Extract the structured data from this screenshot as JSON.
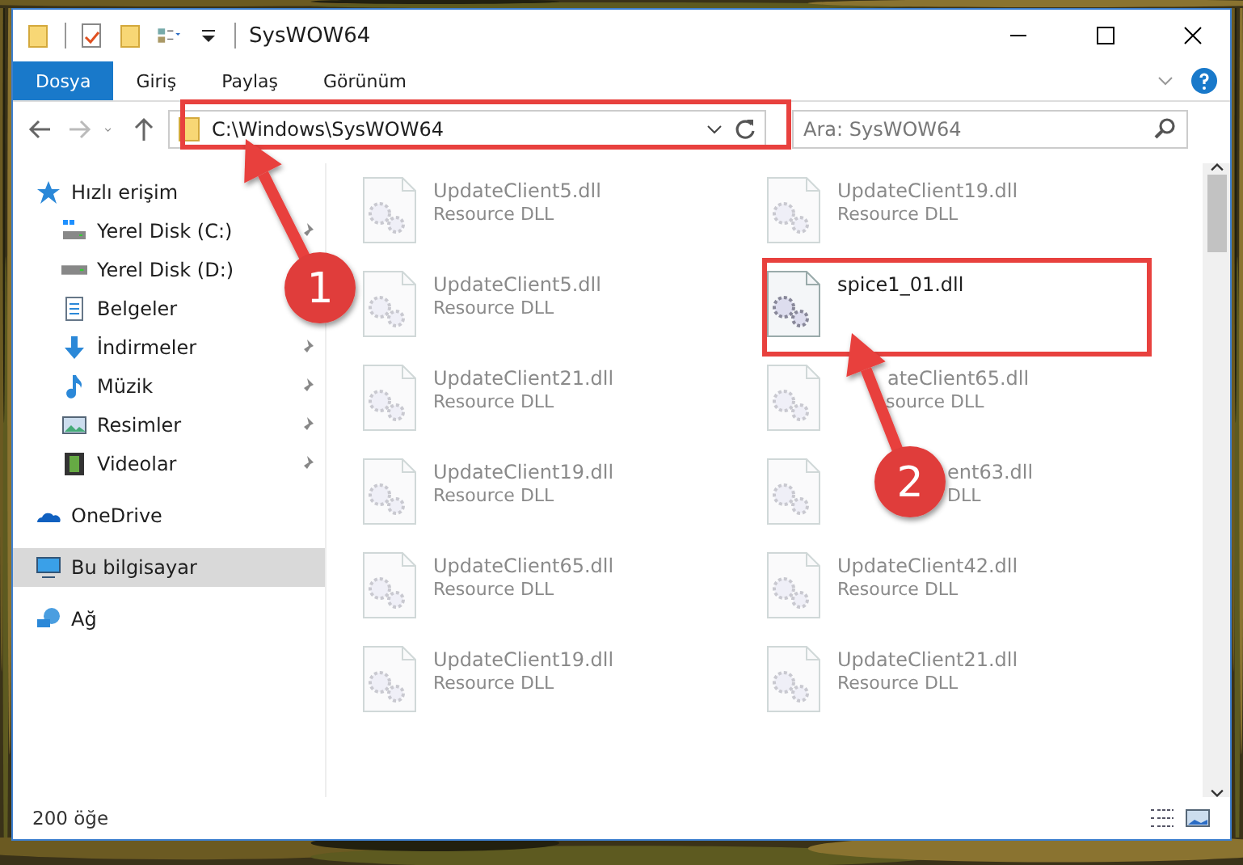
{
  "window": {
    "title": "SysWOW64"
  },
  "ribbon_tabs": [
    {
      "label": "Dosya",
      "selected": true
    },
    {
      "label": "Giriş",
      "selected": false
    },
    {
      "label": "Paylaş",
      "selected": false
    },
    {
      "label": "Görünüm",
      "selected": false
    }
  ],
  "address": {
    "path": "C:\\Windows\\SysWOW64"
  },
  "search": {
    "placeholder": "Ara: SysWOW64"
  },
  "sidebar": {
    "items": [
      {
        "label": "Hızlı erişim",
        "kind": "star",
        "selected": false,
        "children": [
          {
            "label": "Yerel Disk (C:)",
            "kind": "drive-c",
            "pinned": true,
            "selected": false
          },
          {
            "label": "Yerel Disk (D:)",
            "kind": "drive",
            "pinned": false,
            "selected": false
          },
          {
            "label": "Belgeler",
            "kind": "docs",
            "pinned": false,
            "selected": false
          },
          {
            "label": "İndirmeler",
            "kind": "download",
            "pinned": true,
            "selected": false
          },
          {
            "label": "Müzik",
            "kind": "music",
            "pinned": true,
            "selected": false
          },
          {
            "label": "Resimler",
            "kind": "pictures",
            "pinned": true,
            "selected": false
          },
          {
            "label": "Videolar",
            "kind": "videos",
            "pinned": true,
            "selected": false
          }
        ]
      },
      {
        "label": "OneDrive",
        "kind": "cloud",
        "selected": false
      },
      {
        "label": "Bu bilgisayar",
        "kind": "pc",
        "selected": true
      },
      {
        "label": "Ağ",
        "kind": "network",
        "selected": false
      }
    ]
  },
  "files": [
    {
      "name": "UpdateClient5.dll",
      "type": "Resource DLL",
      "dimmed": true
    },
    {
      "name": "UpdateClient19.dll",
      "type": "Resource DLL",
      "dimmed": true
    },
    {
      "name": "UpdateClient5.dll",
      "type": "Resource DLL",
      "dimmed": true
    },
    {
      "name": "spice1_01.dll",
      "dimmed": false
    },
    {
      "name": "UpdateClient21.dll",
      "type": "Resource DLL",
      "dimmed": true
    },
    {
      "name": "ateClient65.dll",
      "type": "source DLL",
      "dimmed": true
    },
    {
      "name": "UpdateClient19.dll",
      "type": "Resource DLL",
      "dimmed": true
    },
    {
      "name": "ent63.dll",
      "type": "DLL",
      "dimmed": true
    },
    {
      "name": "UpdateClient65.dll",
      "type": "Resource DLL",
      "dimmed": true
    },
    {
      "name": "UpdateClient42.dll",
      "type": "Resource DLL",
      "dimmed": true
    },
    {
      "name": "UpdateClient19.dll",
      "type": "Resource DLL",
      "dimmed": true
    },
    {
      "name": "UpdateClient21.dll",
      "type": "Resource DLL",
      "dimmed": true
    }
  ],
  "status_bar": {
    "count": "200 öğe"
  },
  "annotations": [
    {
      "kind": "box"
    },
    {
      "kind": "box"
    },
    {
      "kind": "arrow",
      "label": "1"
    },
    {
      "kind": "arrow",
      "label": "2"
    }
  ]
}
